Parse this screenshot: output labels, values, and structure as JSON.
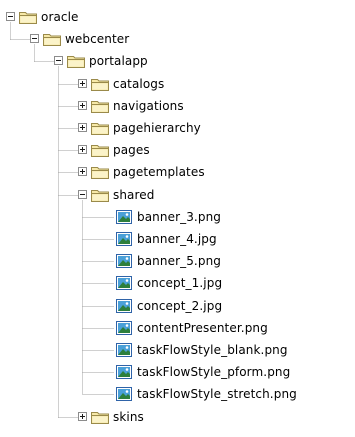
{
  "tree": {
    "nodes": [
      {
        "label": "oracle",
        "type": "folder",
        "expanded": true,
        "level": 0
      },
      {
        "label": "webcenter",
        "type": "folder",
        "expanded": true,
        "level": 1
      },
      {
        "label": "portalapp",
        "type": "folder",
        "expanded": true,
        "level": 2
      },
      {
        "label": "catalogs",
        "type": "folder",
        "expanded": false,
        "level": 3
      },
      {
        "label": "navigations",
        "type": "folder",
        "expanded": false,
        "level": 3
      },
      {
        "label": "pagehierarchy",
        "type": "folder",
        "expanded": false,
        "level": 3
      },
      {
        "label": "pages",
        "type": "folder",
        "expanded": false,
        "level": 3
      },
      {
        "label": "pagetemplates",
        "type": "folder",
        "expanded": false,
        "level": 3
      },
      {
        "label": "shared",
        "type": "folder",
        "expanded": true,
        "level": 3
      },
      {
        "label": "banner_3.png",
        "type": "image-file",
        "level": 4
      },
      {
        "label": "banner_4.jpg",
        "type": "image-file",
        "level": 4
      },
      {
        "label": "banner_5.png",
        "type": "image-file",
        "level": 4
      },
      {
        "label": "concept_1.jpg",
        "type": "image-file",
        "level": 4
      },
      {
        "label": "concept_2.jpg",
        "type": "image-file",
        "level": 4
      },
      {
        "label": "contentPresenter.png",
        "type": "image-file",
        "level": 4
      },
      {
        "label": "taskFlowStyle_blank.png",
        "type": "image-file",
        "level": 4
      },
      {
        "label": "taskFlowStyle_pform.png",
        "type": "image-file",
        "level": 4
      },
      {
        "label": "taskFlowStyle_stretch.png",
        "type": "image-file",
        "level": 4
      },
      {
        "label": "skins",
        "type": "folder",
        "expanded": false,
        "level": 3
      }
    ],
    "icons": {
      "folder": "folder-icon",
      "image-file": "image-file-icon"
    },
    "colors": {
      "folder_fill": "#f7e9a8",
      "folder_outline": "#9a8a4a",
      "image_frame": "#2f63a8",
      "image_fill": "#4aa0d8",
      "tree_line": "#a0a0a0",
      "toggle_border": "#8c8c8c"
    }
  }
}
